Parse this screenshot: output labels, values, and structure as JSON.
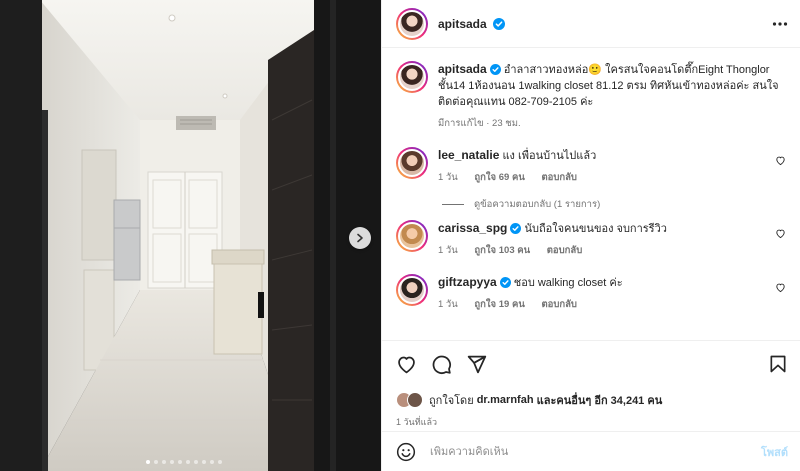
{
  "post": {
    "author": "apitsada",
    "caption_user": "apitsada",
    "caption": "อำลาสาวทองหล่อ🙂 ใครสนใจคอนโดตึ๊กEight Thonglor ชั้น14 1ห้องนอน 1walking closet 81.12 ตรม ทิศหันเข้าทองหล่อค่ะ สนใจติดต่อคุณแทน 082-709-2105 ค่ะ",
    "caption_meta": "มีการแก้ไข · 23 ชม."
  },
  "comments": [
    {
      "user": "lee_natalie",
      "verified": false,
      "text": "แง เพื่อนบ้านไปแล้ว",
      "time": "1 วัน",
      "likes": "ถูกใจ 69 คน",
      "reply": "ตอบกลับ"
    },
    {
      "user": "carissa_spg",
      "verified": true,
      "text": "นับถือใจคนขนของ จบการรีวิว",
      "time": "1 วัน",
      "likes": "ถูกใจ 103 คน",
      "reply": "ตอบกลับ"
    },
    {
      "user": "giftzapyya",
      "verified": true,
      "text": "ชอบ walking closet ค่ะ",
      "time": "1 วัน",
      "likes": "ถูกใจ 19 คน",
      "reply": "ตอบกลับ"
    }
  ],
  "view_replies": "ดูข้อความตอบกลับ (1 รายการ)",
  "likes": {
    "prefix": "ถูกใจโดย",
    "user": "dr.marnfah",
    "suffix": "และคนอื่นๆ อีก 34,241 คน"
  },
  "time_ago": "1 วันที่แล้ว",
  "composer": {
    "placeholder": "เพิ่มความคิดเห็น",
    "post_label": "โพสต์"
  },
  "carousel": {
    "count": 10,
    "active": 0
  },
  "colors": {
    "text": "#262626",
    "muted": "#737373",
    "verified": "#0095f6",
    "post_disabled": "#b2dffc",
    "border": "#efefef"
  }
}
